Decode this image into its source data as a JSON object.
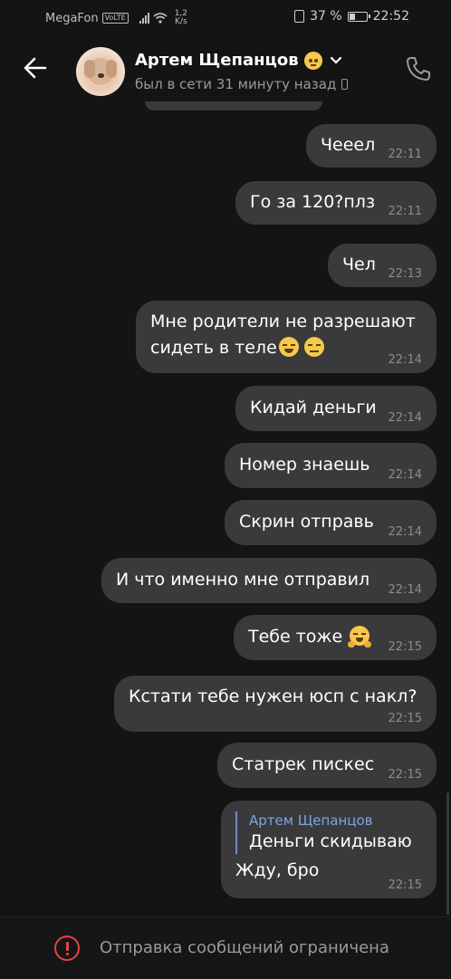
{
  "status_bar": {
    "carrier": "MegaFon",
    "volte": "VoLTE",
    "speed_value": "1,2",
    "speed_unit": "K/s",
    "battery": "37 %",
    "battery_level": 0.37,
    "time": "22:52"
  },
  "header": {
    "name": "Артем Щепанцов",
    "last_seen": "был в сети 31 минуту назад"
  },
  "messages": [
    {
      "text": "Чееел",
      "time": "22:11"
    },
    {
      "text": "Го за 120?плз",
      "time": "22:11"
    },
    {
      "text": "Чел",
      "time": "22:13"
    },
    {
      "text_line1": "Мне родители не разрешают",
      "text_line2": "сидеть в теле",
      "time": "22:14"
    },
    {
      "text": "Кидай деньги",
      "time": "22:14"
    },
    {
      "text": "Номер знаешь",
      "time": "22:14"
    },
    {
      "text": "Скрин отправь",
      "time": "22:14"
    },
    {
      "text": "И что именно мне отправил",
      "time": "22:14"
    },
    {
      "text": "Тебе тоже",
      "time": "22:15"
    },
    {
      "text": "Кстати тебе нужен юсп с накл?",
      "time": "22:15"
    },
    {
      "text": "Статрек пискес",
      "time": "22:15"
    },
    {
      "reply_author": "Артем Щепанцов",
      "reply_text": "Деньги скидываю",
      "text": "Жду, бро",
      "time": "22:15"
    }
  ],
  "bottom": {
    "notice": "Отправка сообщений ограничена"
  },
  "colors": {
    "background": "#141414",
    "bubble": "#3a3a3c",
    "reply_accent": "#7fa4e0",
    "warning": "#e5414b"
  }
}
